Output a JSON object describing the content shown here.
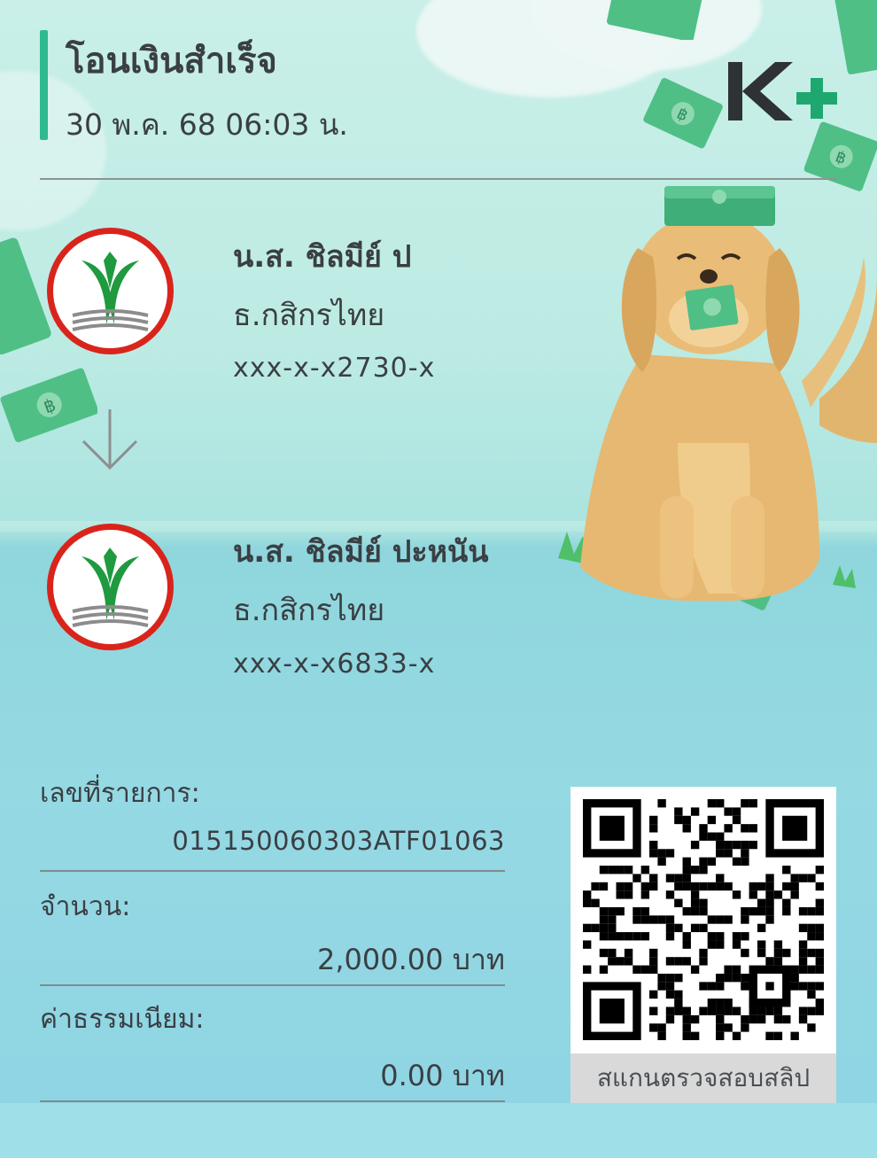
{
  "header": {
    "title": "โอนเงินสำเร็จ",
    "datetime": "30 พ.ค. 68  06:03 น."
  },
  "brand": {
    "logo_text": "K+",
    "accent_color": "#1ea86f",
    "dark_color": "#2e3235"
  },
  "sender": {
    "name": "น.ส. ชิลมีย์ ป",
    "bank": "ธ.กสิกรไทย",
    "account": "xxx-x-x2730-x"
  },
  "receiver": {
    "name": "น.ส. ชิลมีย์ ปะหนัน",
    "bank": "ธ.กสิกรไทย",
    "account": "xxx-x-x6833-x"
  },
  "details": {
    "ref_label": "เลขที่รายการ:",
    "ref_value": "015150060303ATF01063",
    "amount_label": "จำนวน:",
    "amount_value": "2,000.00 บาท",
    "fee_label": "ค่าธรรมเนียม:",
    "fee_value": "0.00 บาท"
  },
  "qr": {
    "caption": "สแกนตรวจสอบสลิป"
  },
  "icons": {
    "bank_logo": "kasikorn-bank-icon",
    "arrow": "arrow-down-icon",
    "qr": "qr-code-icon",
    "illustration": "dog-with-money-illustration"
  }
}
